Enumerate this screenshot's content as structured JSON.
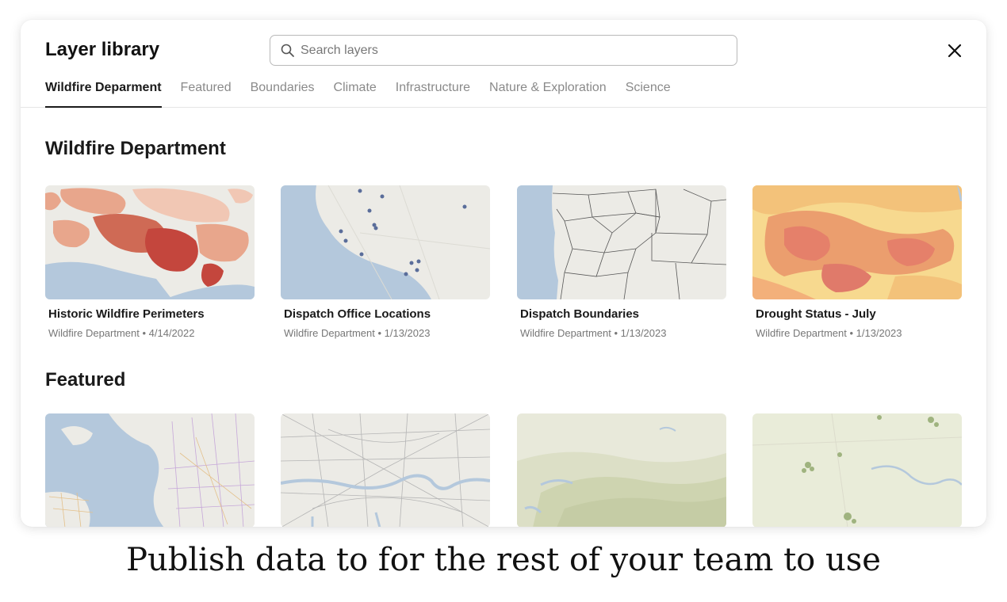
{
  "modal": {
    "title": "Layer library",
    "search": {
      "placeholder": "Search layers",
      "value": ""
    },
    "close_icon": "close-icon"
  },
  "tabs": [
    {
      "label": "Wildfire Deparment",
      "active": true
    },
    {
      "label": "Featured",
      "active": false
    },
    {
      "label": "Boundaries",
      "active": false
    },
    {
      "label": "Climate",
      "active": false
    },
    {
      "label": "Infrastructure",
      "active": false
    },
    {
      "label": "Nature & Exploration",
      "active": false
    },
    {
      "label": "Science",
      "active": false
    }
  ],
  "sections": [
    {
      "title": "Wildfire Department",
      "cards": [
        {
          "name": "Historic Wildfire Perimeters",
          "meta": "Wildfire Department • 4/14/2022"
        },
        {
          "name": "Dispatch Office Locations",
          "meta": "Wildfire Department • 1/13/2023"
        },
        {
          "name": "Dispatch Boundaries",
          "meta": "Wildfire Department • 1/13/2023"
        },
        {
          "name": "Drought Status - July",
          "meta": "Wildfire Department • 1/13/2023"
        }
      ]
    },
    {
      "title": "Featured",
      "cards": [
        {
          "name": "",
          "meta": ""
        },
        {
          "name": "",
          "meta": ""
        },
        {
          "name": "",
          "meta": ""
        },
        {
          "name": "",
          "meta": ""
        }
      ]
    }
  ],
  "tagline": "Publish data to for the rest of your team to use",
  "colors": {
    "water": "#b4c8dc",
    "land": "#ecebe6",
    "wildfire_dark": "#c4463d",
    "wildfire_light": "#e8a68c",
    "drought_yellow": "#f7d98f",
    "drought_orange": "#eb9e6e"
  }
}
